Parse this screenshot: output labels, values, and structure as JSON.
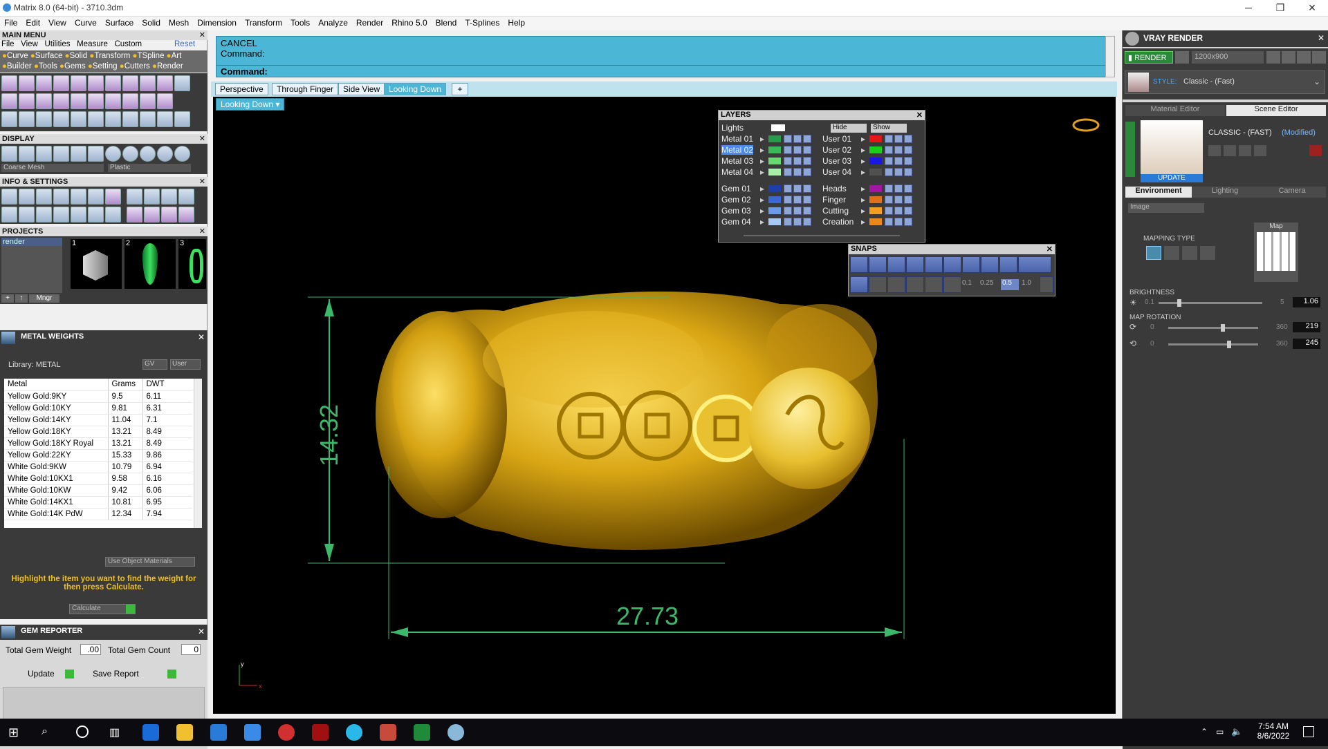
{
  "window": {
    "title": "Matrix 8.0 (64-bit) - 3710.3dm"
  },
  "menubar": [
    "File",
    "Edit",
    "View",
    "Curve",
    "Surface",
    "Solid",
    "Mesh",
    "Dimension",
    "Transform",
    "Tools",
    "Analyze",
    "Render",
    "Rhino 5.0",
    "Blend",
    "T-Splines",
    "Help"
  ],
  "main_menu": {
    "title": "MAIN MENU",
    "row1": [
      "File",
      "View",
      "Utilities",
      "Measure",
      "Custom"
    ],
    "reset": "Reset",
    "row2": [
      "Curve",
      "Surface",
      "Solid",
      "Transform",
      "TSpline",
      "Art"
    ],
    "row3": [
      "Builder",
      "Tools",
      "Gems",
      "Setting",
      "Cutters",
      "Render"
    ]
  },
  "display": {
    "title": "DISPLAY",
    "mesh_select": "Coarse Mesh",
    "material_select": "Plastic"
  },
  "info_settings": {
    "title": "INFO & SETTINGS"
  },
  "projects": {
    "title": "PROJECTS",
    "item": "render",
    "thumb_numbers": [
      "1",
      "2",
      "3"
    ],
    "mngr": "Mngr"
  },
  "metal_weights": {
    "title": "METAL WEIGHTS",
    "library": "Library: METAL",
    "gv": "GV",
    "user": "User",
    "headers": [
      "Metal",
      "Grams",
      "DWT"
    ],
    "rows": [
      [
        "Yellow Gold:9KY",
        "9.5",
        "6.11"
      ],
      [
        "Yellow Gold:10KY",
        "9.81",
        "6.31"
      ],
      [
        "Yellow Gold:14KY",
        "11.04",
        "7.1"
      ],
      [
        "Yellow Gold:18KY",
        "13.21",
        "8.49"
      ],
      [
        "Yellow Gold:18KY Royal",
        "13.21",
        "8.49"
      ],
      [
        "Yellow Gold:22KY",
        "15.33",
        "9.86"
      ],
      [
        "White Gold:9KW",
        "10.79",
        "6.94"
      ],
      [
        "White Gold:10KX1",
        "9.58",
        "6.16"
      ],
      [
        "White Gold:10KW",
        "9.42",
        "6.06"
      ],
      [
        "White Gold:14KX1",
        "10.81",
        "6.95"
      ],
      [
        "White Gold:14K PdW",
        "12.34",
        "7.94"
      ]
    ],
    "use_object_materials": "Use Object Materials",
    "hint": "Highlight the item you want to find the weight for then press Calculate.",
    "calculate": "Calculate"
  },
  "gem_reporter": {
    "title": "GEM REPORTER",
    "total_weight_label": "Total Gem Weight",
    "total_weight": ".00",
    "total_count_label": "Total Gem Count",
    "total_count": "0",
    "update": "Update",
    "save_report": "Save Report"
  },
  "command": {
    "line1": "CANCEL",
    "line2": "Command:",
    "prompt": "Command:"
  },
  "view_tabs": [
    "Perspective",
    "Through Finger",
    "Side View",
    "Looking Down"
  ],
  "active_view_label": "Looking Down",
  "dimensions": {
    "height": "14.32",
    "width": "27.73"
  },
  "axis": {
    "y": "y",
    "x": "x"
  },
  "layers": {
    "title": "LAYERS",
    "lights": "Lights",
    "hide": "Hide",
    "show": "Show",
    "left": [
      {
        "name": "Metal 01",
        "color": "#2a9a4a"
      },
      {
        "name": "Metal 02",
        "color": "#3ab85a"
      },
      {
        "name": "Metal 03",
        "color": "#6ad870"
      },
      {
        "name": "Metal 04",
        "color": "#a8f0a8"
      },
      {
        "name": "Gem 01",
        "color": "#1e3ea8"
      },
      {
        "name": "Gem 02",
        "color": "#3a68d0"
      },
      {
        "name": "Gem 03",
        "color": "#6a9ae8"
      },
      {
        "name": "Gem 04",
        "color": "#a8c8f4"
      }
    ],
    "right": [
      {
        "name": "User 01",
        "color": "#e01818"
      },
      {
        "name": "User 02",
        "color": "#18d018"
      },
      {
        "name": "User 03",
        "color": "#1818e0"
      },
      {
        "name": "User 04",
        "color": "#505050"
      },
      {
        "name": "Heads",
        "color": "#a018a0"
      },
      {
        "name": "Finger",
        "color": "#e07018"
      },
      {
        "name": "Cutting",
        "color": "#f0a020"
      },
      {
        "name": "Creation",
        "color": "#e88a1a"
      }
    ]
  },
  "snaps": {
    "title": "SNAPS",
    "values": [
      "0.1",
      "0.25",
      "0.5",
      "1.0"
    ]
  },
  "vray": {
    "title": "VRAY RENDER",
    "render": "RENDER",
    "resolution": "1200x900",
    "style_label": "STYLE:",
    "style_value": "Classic - (Fast)",
    "tabs_top": [
      "Material Editor",
      "Scene Editor"
    ],
    "material_name": "CLASSIC - (FAST)",
    "modified": "(Modified)",
    "update": "UPDATE",
    "tabs_env": [
      "Environment",
      "Lighting",
      "Camera"
    ],
    "env_select": "Image",
    "mapping_type": "MAPPING TYPE",
    "map": "Map",
    "brightness": {
      "label": "BRIGHTNESS",
      "min": "0.1",
      "max": "5",
      "value": "1.06",
      "level": 0.2
    },
    "map_rotation": {
      "label": "MAP ROTATION",
      "min": "0",
      "max": "360",
      "value1": "219",
      "value2": "245",
      "level1": 0.61,
      "level2": 0.68
    }
  },
  "taskbar": {
    "time": "7:54 AM",
    "date": "8/6/2022"
  },
  "colors": {
    "cmd": "#4bb6d6",
    "gold": "#d9a614",
    "dim": "#3cb86a"
  }
}
